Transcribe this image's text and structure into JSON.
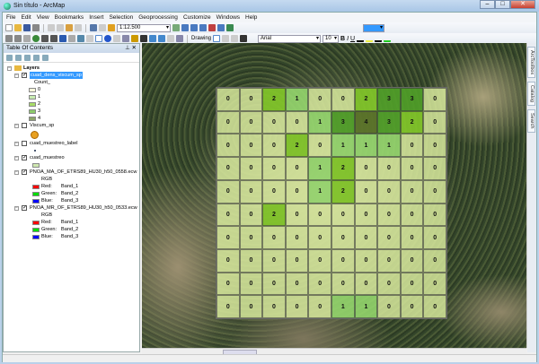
{
  "window": {
    "title": "Sin título - ArcMap"
  },
  "menu": [
    "File",
    "Edit",
    "View",
    "Bookmarks",
    "Insert",
    "Selection",
    "Geoprocessing",
    "Customize",
    "Windows",
    "Help"
  ],
  "toolbar": {
    "scale": "1:12.500",
    "drawing_label": "Drawing",
    "font": "Arial",
    "font_size": "10",
    "bold": "B",
    "italic": "I",
    "underline": "U"
  },
  "toc": {
    "title": "Table Of Contents",
    "root": "Layers",
    "layers": [
      {
        "name": "cuad_dens_viscum_sp",
        "checked": true,
        "selected": true,
        "field": "Count_",
        "classes": [
          {
            "label": "0",
            "color": "#fbf8dc"
          },
          {
            "label": "1",
            "color": "#c8ecb0"
          },
          {
            "label": "2",
            "color": "#a8dc68"
          },
          {
            "label": "3",
            "color": "#8ccb6a"
          },
          {
            "label": "4",
            "color": "#8da56a"
          }
        ]
      },
      {
        "name": "Viscum_sp",
        "checked": false
      },
      {
        "name": "cuad_muestreo_label",
        "checked": false
      },
      {
        "name": "cuad_muestreo",
        "checked": true
      },
      {
        "name": "PNOA_MA_OF_ETRS89_HU30_h50_0558.ecw",
        "checked": true,
        "rgb": "RGB",
        "bands": [
          {
            "label": "Red:",
            "band": "Band_1",
            "color": "#ff0000"
          },
          {
            "label": "Green:",
            "band": "Band_2",
            "color": "#00dd00"
          },
          {
            "label": "Blue:",
            "band": "Band_3",
            "color": "#0000ff"
          }
        ]
      },
      {
        "name": "PNOA_MR_OF_ETRS89_HU30_h50_0533.ecw",
        "checked": true,
        "rgb": "RGB",
        "bands": [
          {
            "label": "Red:",
            "band": "Band_1",
            "color": "#ff0000"
          },
          {
            "label": "Green:",
            "band": "Band_2",
            "color": "#00dd00"
          },
          {
            "label": "Blue:",
            "band": "Band_3",
            "color": "#0000ff"
          }
        ]
      }
    ]
  },
  "side_tabs": [
    "ArcToolbox",
    "Catalog",
    "Search"
  ],
  "grid": {
    "colors": {
      "0": "rgba(220,238,160,0.82)",
      "1": "rgba(150,220,110,0.85)",
      "2": "rgba(130,200,40,0.9)",
      "3": "rgba(80,160,40,0.9)",
      "4": "rgba(90,115,40,0.92)"
    },
    "values": [
      [
        0,
        0,
        2,
        1,
        0,
        0,
        2,
        3,
        3,
        0
      ],
      [
        0,
        0,
        0,
        0,
        1,
        3,
        4,
        3,
        2,
        0
      ],
      [
        0,
        0,
        0,
        2,
        0,
        1,
        1,
        1,
        0,
        0
      ],
      [
        0,
        0,
        0,
        0,
        1,
        2,
        0,
        0,
        0,
        0
      ],
      [
        0,
        0,
        0,
        0,
        1,
        2,
        0,
        0,
        0,
        0
      ],
      [
        0,
        0,
        2,
        0,
        0,
        0,
        0,
        0,
        0,
        0
      ],
      [
        0,
        0,
        0,
        0,
        0,
        0,
        0,
        0,
        0,
        0
      ],
      [
        0,
        0,
        0,
        0,
        0,
        0,
        0,
        0,
        0,
        0
      ],
      [
        0,
        0,
        0,
        0,
        0,
        0,
        0,
        0,
        0,
        0
      ],
      [
        0,
        0,
        0,
        0,
        0,
        1,
        1,
        0,
        0,
        0
      ]
    ]
  }
}
